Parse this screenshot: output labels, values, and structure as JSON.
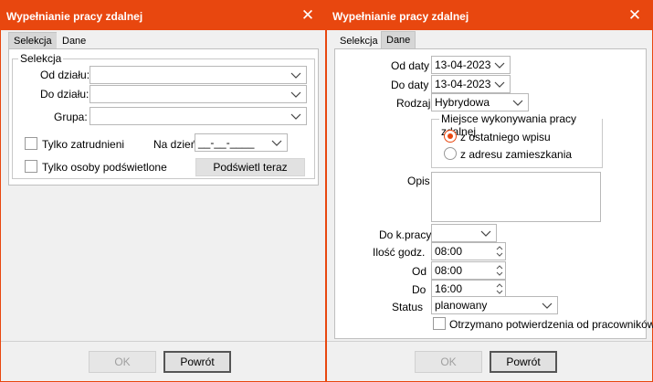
{
  "left": {
    "title": "Wypełnianie pracy zdalnej",
    "close_glyph": "✕",
    "tabs": [
      "Selekcja",
      "Dane"
    ],
    "group_title": "Selekcja",
    "od_dzialu_label": "Od działu:",
    "do_dzialu_label": "Do działu:",
    "grupa_label": "Grupa:",
    "od_dzialu_value": "",
    "do_dzialu_value": "",
    "grupa_value": "",
    "tylko_zatrudnieni_label": "Tylko zatrudnieni",
    "na_dzien_label": "Na dzień",
    "na_dzien_value": "__-__-____",
    "tylko_osoby_label": "Tylko osoby podświetlone",
    "podswietl_button": "Podświetl teraz",
    "ok_button": "OK",
    "powrot_button": "Powrót"
  },
  "right": {
    "title": "Wypełnianie pracy zdalnej",
    "close_glyph": "✕",
    "tabs": [
      "Selekcja",
      "Dane"
    ],
    "od_daty_label": "Od daty",
    "od_daty_value": "13-04-2023",
    "do_daty_label": "Do daty",
    "do_daty_value": "13-04-2023",
    "rodzaj_label": "Rodzaj",
    "rodzaj_value": "Hybrydowa",
    "miejsce_group": "Miejsce wykonywania pracy zdalnej",
    "radio_ostatniego": "z ostatniego wpisu",
    "radio_adresu": "z adresu zamieszkania",
    "opis_label": "Opis",
    "opis_value": "",
    "do_kpracy_label": "Do k.pracy",
    "do_kpracy_value": "",
    "ilosc_label": "Ilość godz.",
    "ilosc_value": "08:00",
    "od_label": "Od",
    "od_value": "08:00",
    "do_label": "Do",
    "do_value": "16:00",
    "status_label": "Status",
    "status_value": "planowany",
    "otrzymano_label": "Otrzymano potwierdzenia od pracowników",
    "ok_button": "OK",
    "powrot_button": "Powrót"
  },
  "colors": {
    "accent": "#e8470f",
    "window_bg": "#f0f0f0",
    "panel_bg": "#ffffff"
  }
}
